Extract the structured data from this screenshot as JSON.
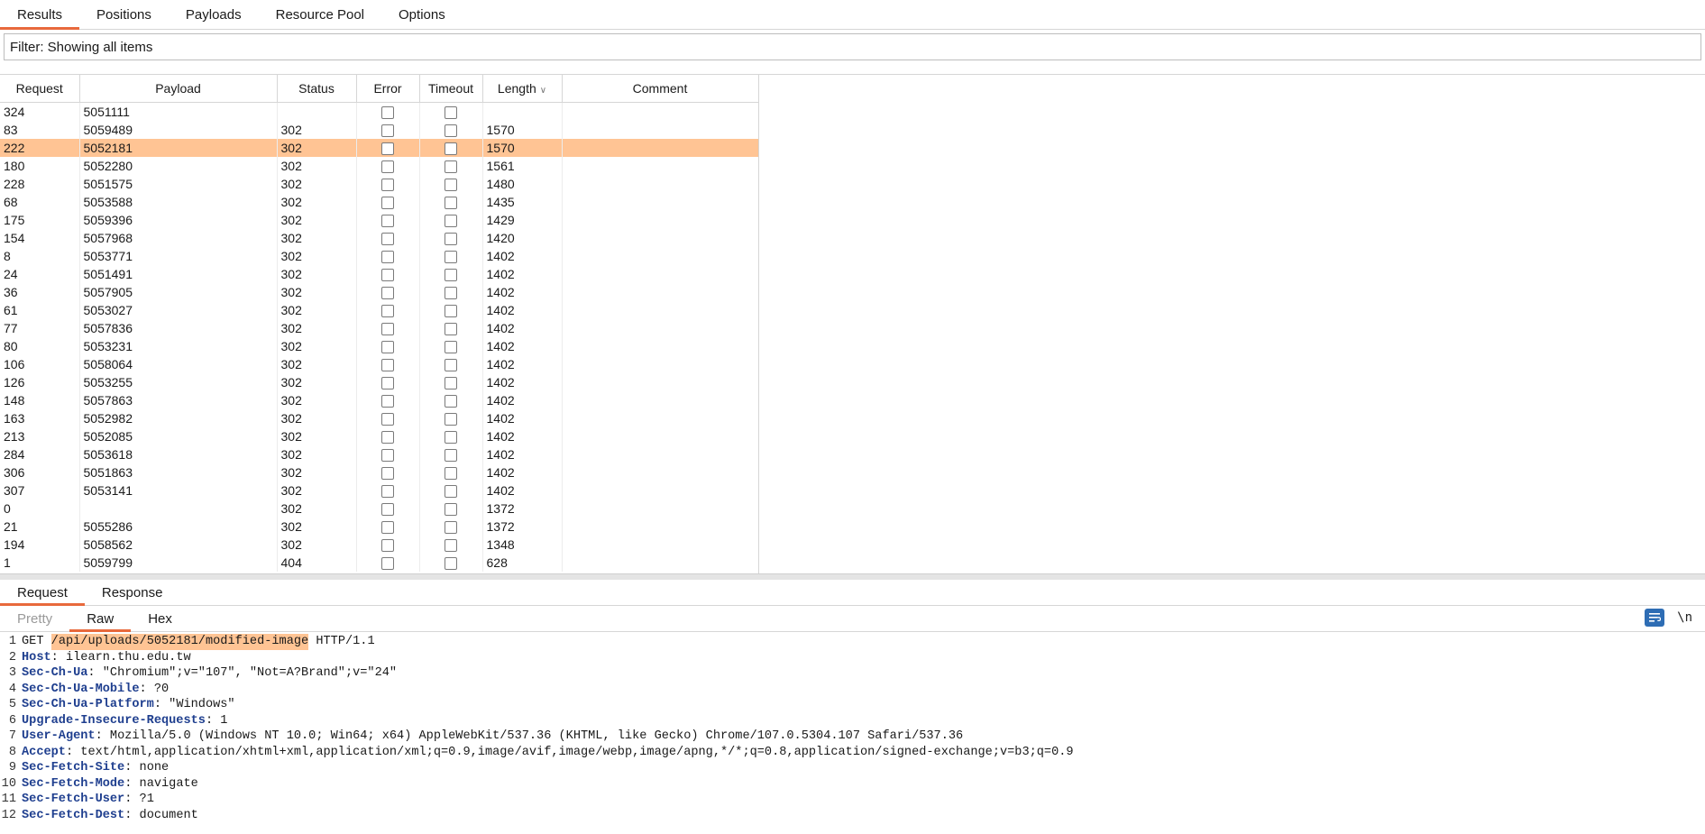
{
  "top_tabs": [
    "Results",
    "Positions",
    "Payloads",
    "Resource Pool",
    "Options"
  ],
  "filter": {
    "text": "Filter: Showing all items"
  },
  "table": {
    "columns": [
      "Request",
      "Payload",
      "Status",
      "Error",
      "Timeout",
      "Length",
      "Comment"
    ],
    "rows": [
      [
        "324",
        "5051111",
        "",
        "",
        ""
      ],
      [
        "83",
        "5059489",
        "302",
        "1570",
        ""
      ],
      [
        "222",
        "5052181",
        "302",
        "1570",
        ""
      ],
      [
        "180",
        "5052280",
        "302",
        "1561",
        ""
      ],
      [
        "228",
        "5051575",
        "302",
        "1480",
        ""
      ],
      [
        "68",
        "5053588",
        "302",
        "1435",
        ""
      ],
      [
        "175",
        "5059396",
        "302",
        "1429",
        ""
      ],
      [
        "154",
        "5057968",
        "302",
        "1420",
        ""
      ],
      [
        "8",
        "5053771",
        "302",
        "1402",
        ""
      ],
      [
        "24",
        "5051491",
        "302",
        "1402",
        ""
      ],
      [
        "36",
        "5057905",
        "302",
        "1402",
        ""
      ],
      [
        "61",
        "5053027",
        "302",
        "1402",
        ""
      ],
      [
        "77",
        "5057836",
        "302",
        "1402",
        ""
      ],
      [
        "80",
        "5053231",
        "302",
        "1402",
        ""
      ],
      [
        "106",
        "5058064",
        "302",
        "1402",
        ""
      ],
      [
        "126",
        "5053255",
        "302",
        "1402",
        ""
      ],
      [
        "148",
        "5057863",
        "302",
        "1402",
        ""
      ],
      [
        "163",
        "5052982",
        "302",
        "1402",
        ""
      ],
      [
        "213",
        "5052085",
        "302",
        "1402",
        ""
      ],
      [
        "284",
        "5053618",
        "302",
        "1402",
        ""
      ],
      [
        "306",
        "5051863",
        "302",
        "1402",
        ""
      ],
      [
        "307",
        "5053141",
        "302",
        "1402",
        ""
      ],
      [
        "0",
        "",
        "302",
        "1372",
        ""
      ],
      [
        "21",
        "5055286",
        "302",
        "1372",
        ""
      ],
      [
        "194",
        "5058562",
        "302",
        "1348",
        ""
      ],
      [
        "1",
        "5059799",
        "404",
        "628",
        ""
      ]
    ],
    "selected_row": 2
  },
  "panel_tabs": [
    "Request",
    "Response"
  ],
  "view_tabs": [
    "Pretty",
    "Raw",
    "Hex"
  ],
  "newline_toggle": "\\n",
  "request": {
    "method": "GET",
    "path": "/api/uploads/5052181/modified-image",
    "protocol": "HTTP/1.1",
    "headers": [
      {
        "name": "Host",
        "value": "ilearn.thu.edu.tw"
      },
      {
        "name": "Sec-Ch-Ua",
        "value": "\"Chromium\";v=\"107\", \"Not=A?Brand\";v=\"24\""
      },
      {
        "name": "Sec-Ch-Ua-Mobile",
        "value": "?0"
      },
      {
        "name": "Sec-Ch-Ua-Platform",
        "value": "\"Windows\""
      },
      {
        "name": "Upgrade-Insecure-Requests",
        "value": "1"
      },
      {
        "name": "User-Agent",
        "value": "Mozilla/5.0 (Windows NT 10.0; Win64; x64) AppleWebKit/537.36 (KHTML, like Gecko) Chrome/107.0.5304.107 Safari/537.36"
      },
      {
        "name": "Accept",
        "value": "text/html,application/xhtml+xml,application/xml;q=0.9,image/avif,image/webp,image/apng,*/*;q=0.8,application/signed-exchange;v=b3;q=0.9"
      },
      {
        "name": "Sec-Fetch-Site",
        "value": "none"
      },
      {
        "name": "Sec-Fetch-Mode",
        "value": "navigate"
      },
      {
        "name": "Sec-Fetch-User",
        "value": "?1"
      },
      {
        "name": "Sec-Fetch-Dest",
        "value": "document"
      }
    ]
  },
  "colors": {
    "accent": "#e8693c",
    "selection": "#ffc494",
    "header_key": "#1f3f8f",
    "button": "#2e6db4"
  }
}
